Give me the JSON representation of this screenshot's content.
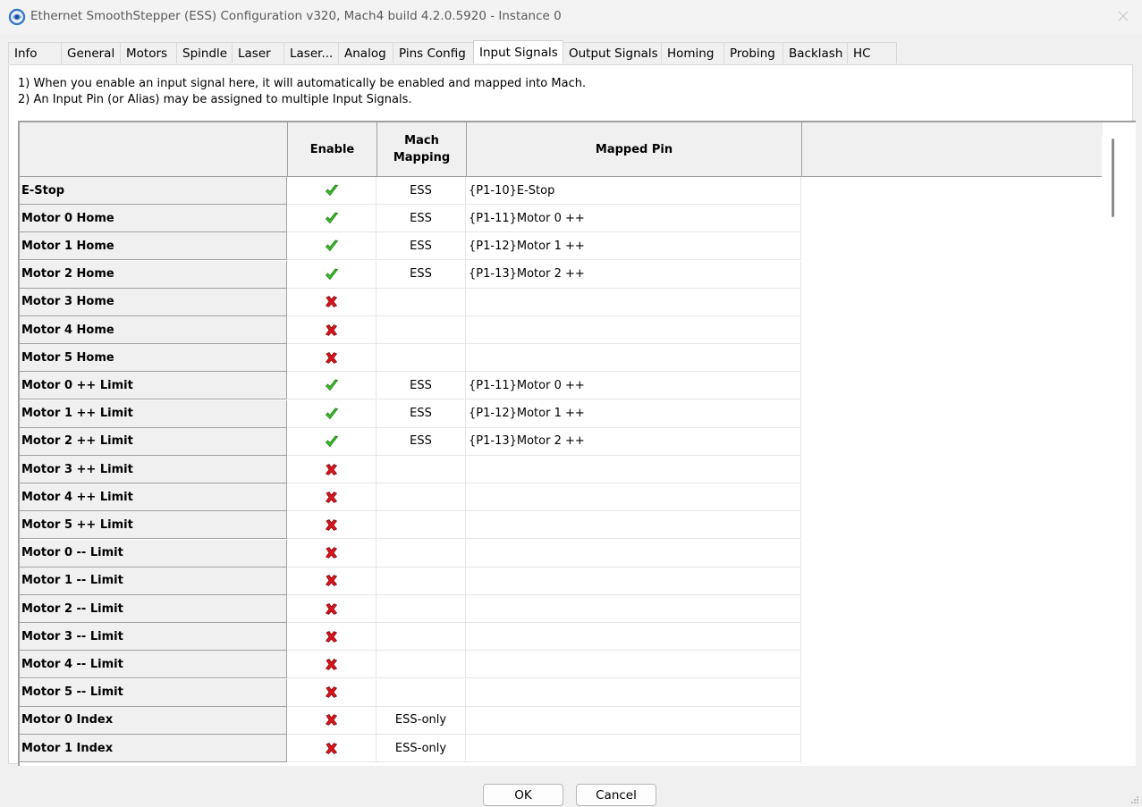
{
  "window": {
    "title": "Ethernet SmoothStepper (ESS) Configuration v320, Mach4 build 4.2.0.5920 - Instance 0",
    "icon": "app-logo-icon"
  },
  "tabs": [
    {
      "label": "Info",
      "active": false
    },
    {
      "label": "General",
      "active": false
    },
    {
      "label": "Motors",
      "active": false
    },
    {
      "label": "Spindle",
      "active": false
    },
    {
      "label": "Laser",
      "active": false
    },
    {
      "label": "Laser...",
      "active": false
    },
    {
      "label": "Analog",
      "active": false
    },
    {
      "label": "Pins Config",
      "active": false
    },
    {
      "label": "Input Signals",
      "active": true
    },
    {
      "label": "Output Signals",
      "active": false
    },
    {
      "label": "Homing",
      "active": false
    },
    {
      "label": "Probing",
      "active": false
    },
    {
      "label": "Backlash",
      "active": false
    },
    {
      "label": "HC",
      "active": false
    }
  ],
  "notes": {
    "line1": "1) When you enable an input signal here, it will automatically be enabled and mapped into Mach.",
    "line2": "2) An Input Pin (or Alias) may be assigned to multiple Input Signals."
  },
  "grid": {
    "headers": {
      "enable": "Enable",
      "mach_mapping": "Mach Mapping",
      "mapped_pin": "Mapped Pin"
    },
    "rows": [
      {
        "name": "E-Stop",
        "enabled": true,
        "mapping": "ESS",
        "pin": "{P1-10}E-Stop"
      },
      {
        "name": "Motor 0 Home",
        "enabled": true,
        "mapping": "ESS",
        "pin": "{P1-11}Motor 0 ++"
      },
      {
        "name": "Motor 1 Home",
        "enabled": true,
        "mapping": "ESS",
        "pin": "{P1-12}Motor 1 ++"
      },
      {
        "name": "Motor 2 Home",
        "enabled": true,
        "mapping": "ESS",
        "pin": "{P1-13}Motor 2 ++"
      },
      {
        "name": "Motor 3 Home",
        "enabled": false,
        "mapping": "",
        "pin": ""
      },
      {
        "name": "Motor 4 Home",
        "enabled": false,
        "mapping": "",
        "pin": ""
      },
      {
        "name": "Motor 5 Home",
        "enabled": false,
        "mapping": "",
        "pin": ""
      },
      {
        "name": "Motor 0 ++ Limit",
        "enabled": true,
        "mapping": "ESS",
        "pin": "{P1-11}Motor 0 ++"
      },
      {
        "name": "Motor 1 ++ Limit",
        "enabled": true,
        "mapping": "ESS",
        "pin": "{P1-12}Motor 1 ++"
      },
      {
        "name": "Motor 2 ++ Limit",
        "enabled": true,
        "mapping": "ESS",
        "pin": "{P1-13}Motor 2 ++"
      },
      {
        "name": "Motor 3 ++ Limit",
        "enabled": false,
        "mapping": "",
        "pin": ""
      },
      {
        "name": "Motor 4 ++ Limit",
        "enabled": false,
        "mapping": "",
        "pin": ""
      },
      {
        "name": "Motor 5 ++ Limit",
        "enabled": false,
        "mapping": "",
        "pin": ""
      },
      {
        "name": "Motor 0 -- Limit",
        "enabled": false,
        "mapping": "",
        "pin": ""
      },
      {
        "name": "Motor 1 -- Limit",
        "enabled": false,
        "mapping": "",
        "pin": ""
      },
      {
        "name": "Motor 2 -- Limit",
        "enabled": false,
        "mapping": "",
        "pin": ""
      },
      {
        "name": "Motor 3 -- Limit",
        "enabled": false,
        "mapping": "",
        "pin": ""
      },
      {
        "name": "Motor 4 -- Limit",
        "enabled": false,
        "mapping": "",
        "pin": ""
      },
      {
        "name": "Motor 5 -- Limit",
        "enabled": false,
        "mapping": "",
        "pin": ""
      },
      {
        "name": "Motor 0 Index",
        "enabled": false,
        "mapping": "ESS-only",
        "pin": ""
      },
      {
        "name": "Motor 1 Index",
        "enabled": false,
        "mapping": "ESS-only",
        "pin": ""
      }
    ]
  },
  "buttons": {
    "ok": "OK",
    "cancel": "Cancel"
  },
  "colors": {
    "check_green": "#3bbf2a",
    "cross_red": "#d9141b",
    "header_bg": "#f0f0f0",
    "grid_border": "#a0a0a0"
  }
}
